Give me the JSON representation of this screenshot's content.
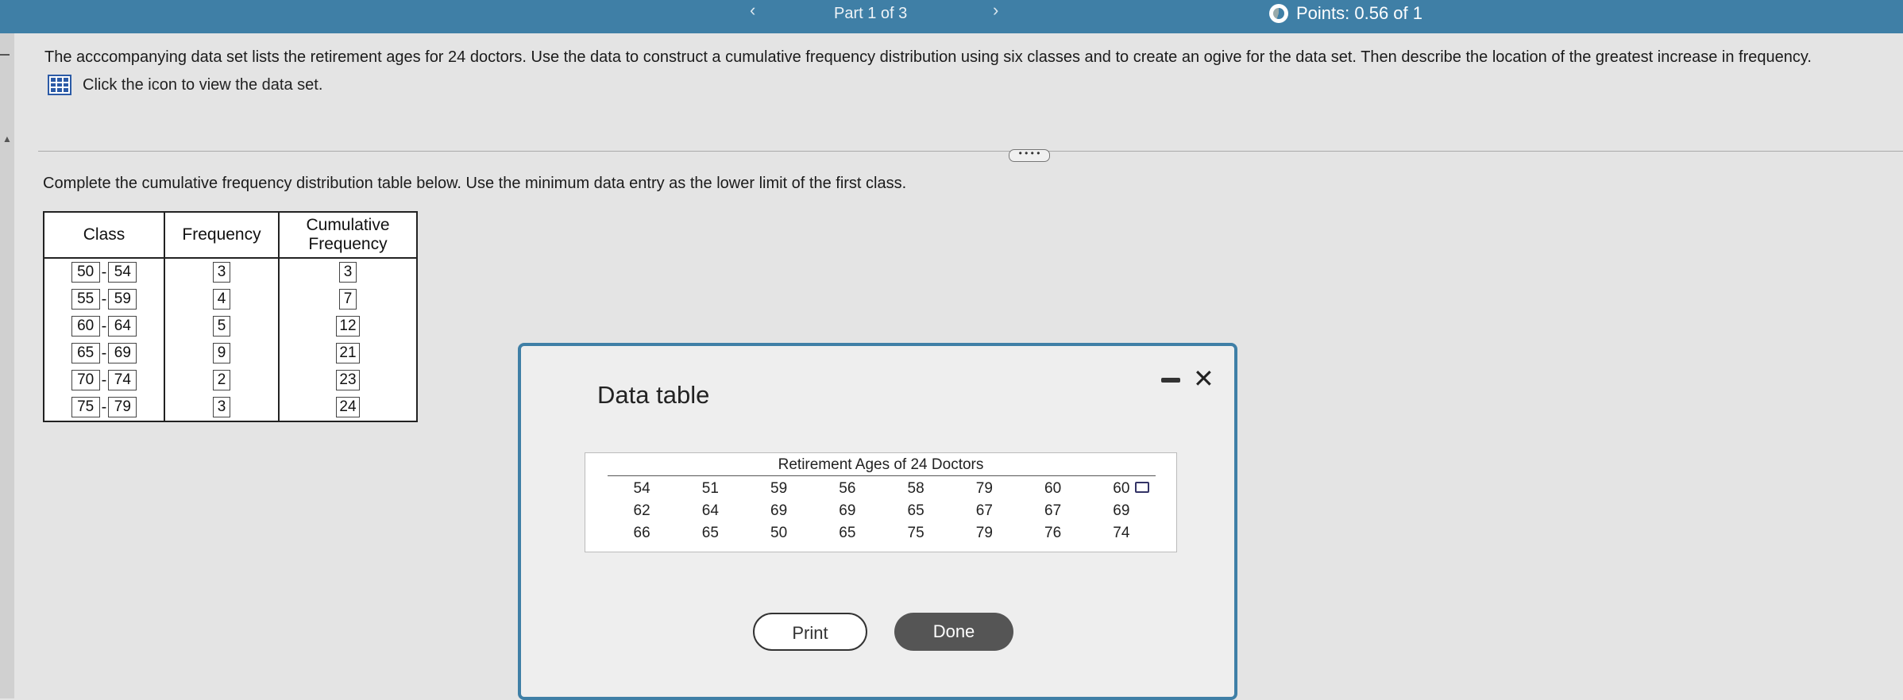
{
  "header": {
    "prev_arrow": "‹",
    "next_arrow": "›",
    "part_label": "Part 1 of 3",
    "points_label": "Points: 0.56 of 1"
  },
  "question": {
    "text": "The acccompanying data set lists the retirement ages for 24 doctors. Use the data to construct a cumulative frequency distribution using six classes and to create an ogive for the data set. Then describe the location of the greatest increase in frequency.",
    "dataset_link": "Click the icon to view the data set."
  },
  "more_button": "• • • •",
  "instruction": "Complete the cumulative frequency distribution table below. Use the minimum data entry as the lower limit of the first class.",
  "table": {
    "headers": {
      "class": "Class",
      "frequency": "Frequency",
      "cumulative": "Cumulative Frequency"
    },
    "separator": "-",
    "rows": [
      {
        "lower": "50",
        "upper": "54",
        "frequency": "3",
        "cumulative": "3"
      },
      {
        "lower": "55",
        "upper": "59",
        "frequency": "4",
        "cumulative": "7"
      },
      {
        "lower": "60",
        "upper": "64",
        "frequency": "5",
        "cumulative": "12"
      },
      {
        "lower": "65",
        "upper": "69",
        "frequency": "9",
        "cumulative": "21"
      },
      {
        "lower": "70",
        "upper": "74",
        "frequency": "2",
        "cumulative": "23"
      },
      {
        "lower": "75",
        "upper": "79",
        "frequency": "3",
        "cumulative": "24"
      }
    ]
  },
  "modal": {
    "title": "Data table",
    "close": "✕",
    "caption": "Retirement Ages of 24 Doctors",
    "values": [
      [
        "54",
        "51",
        "59",
        "56",
        "58",
        "79",
        "60",
        "60"
      ],
      [
        "62",
        "64",
        "69",
        "69",
        "65",
        "67",
        "67",
        "69"
      ],
      [
        "66",
        "65",
        "50",
        "65",
        "75",
        "79",
        "76",
        "74"
      ]
    ],
    "print_label": "Print",
    "done_label": "Done"
  }
}
